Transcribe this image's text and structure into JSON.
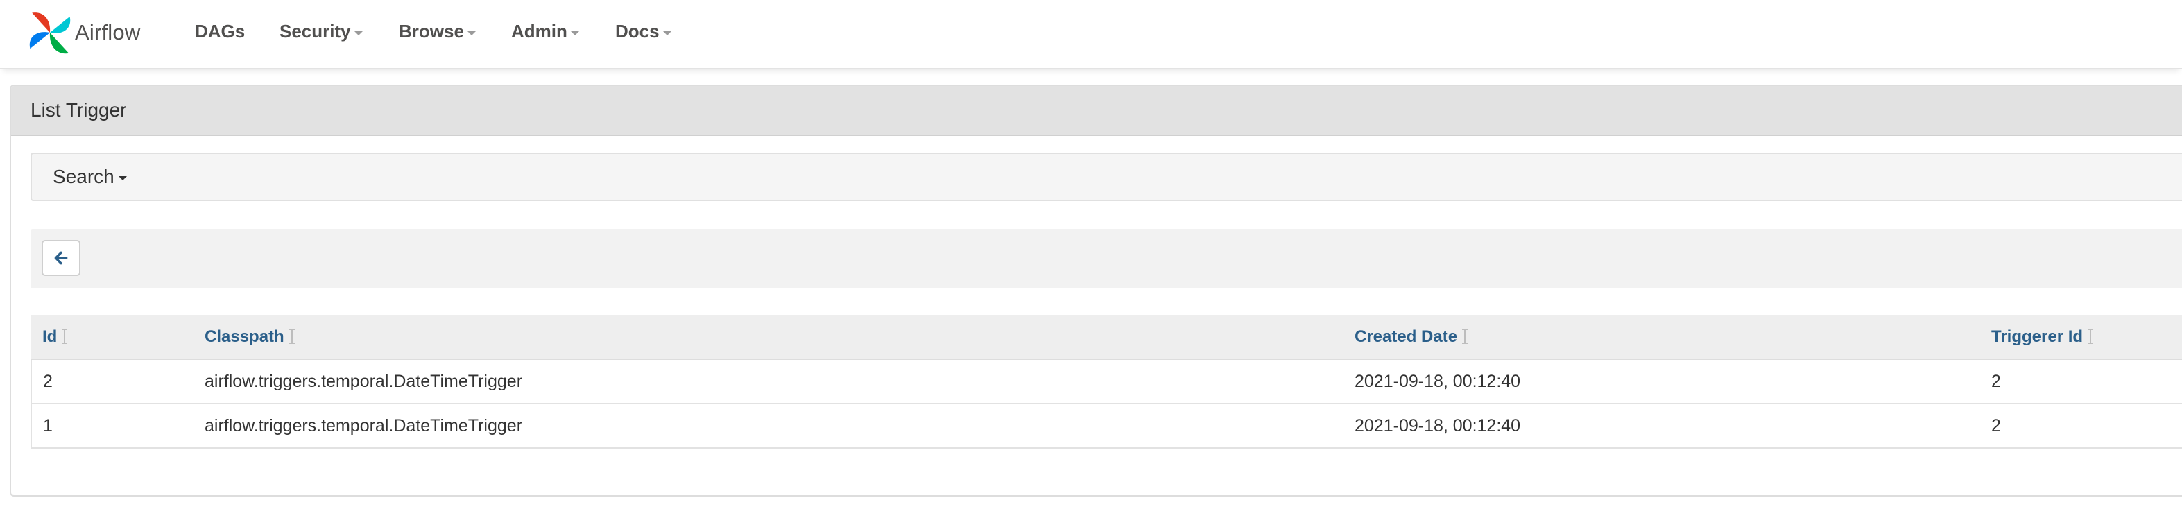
{
  "navbar": {
    "brand": "Airflow",
    "menu": [
      {
        "label": "DAGs",
        "dropdown": false
      },
      {
        "label": "Security",
        "dropdown": true
      },
      {
        "label": "Browse",
        "dropdown": true
      },
      {
        "label": "Admin",
        "dropdown": true
      },
      {
        "label": "Docs",
        "dropdown": true
      }
    ]
  },
  "panel": {
    "title": "List Trigger"
  },
  "search": {
    "label": "Search"
  },
  "toolbar": {
    "back_icon": "arrow-left-icon"
  },
  "table": {
    "columns": [
      "Id",
      "Classpath",
      "Created Date",
      "Triggerer Id"
    ],
    "rows": [
      [
        "2",
        "airflow.triggers.temporal.DateTimeTrigger",
        "2021-09-18, 00:12:40",
        "2"
      ],
      [
        "1",
        "airflow.triggers.temporal.DateTimeTrigger",
        "2021-09-18, 00:12:40",
        "2"
      ]
    ]
  },
  "colors": {
    "link_header": "#2b5f8a",
    "panel_heading_bg": "#e2e2e2",
    "logo": [
      "#017cee",
      "#00ad46",
      "#e43921",
      "#00c7d4"
    ]
  }
}
